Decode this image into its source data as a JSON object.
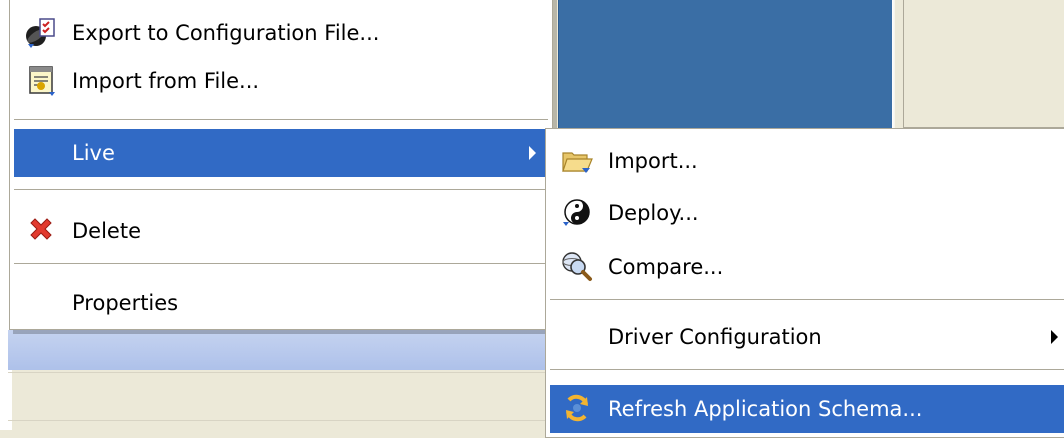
{
  "main_menu": {
    "items": [
      {
        "label": "Export to Configuration File...",
        "icon": "export-config-icon"
      },
      {
        "label": "Import from File...",
        "icon": "import-file-icon"
      },
      {
        "label": "Live",
        "has_submenu": true,
        "selected": true
      },
      {
        "label": "Delete",
        "icon": "delete-icon"
      },
      {
        "label": "Properties"
      }
    ]
  },
  "live_submenu": {
    "items": [
      {
        "label": "Import...",
        "icon": "folder-open-icon"
      },
      {
        "label": "Deploy...",
        "icon": "deploy-icon"
      },
      {
        "label": "Compare...",
        "icon": "compare-icon"
      },
      {
        "label": "Driver Configuration",
        "has_submenu": true
      },
      {
        "label": "Refresh Application Schema...",
        "icon": "refresh-icon",
        "selected": true
      }
    ]
  },
  "colors": {
    "selection": "#316ac5",
    "menu_background": "#ffffff",
    "separator": "#aca899",
    "window_background": "#ece9d8",
    "panel_blue": "#3a6ea5"
  }
}
